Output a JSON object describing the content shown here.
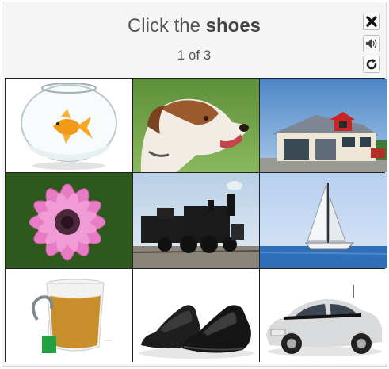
{
  "captcha": {
    "prompt_prefix": "Click the",
    "prompt_target": "shoes",
    "progress": "1 of 3",
    "controls": [
      {
        "name": "close-icon",
        "glyph": "✖"
      },
      {
        "name": "audio-icon",
        "glyph": "🔊"
      },
      {
        "name": "refresh-icon",
        "glyph": "↻"
      }
    ],
    "tiles": [
      {
        "name": "tile-goldfish"
      },
      {
        "name": "tile-dog"
      },
      {
        "name": "tile-house"
      },
      {
        "name": "tile-flower"
      },
      {
        "name": "tile-locomotive"
      },
      {
        "name": "tile-sailboat"
      },
      {
        "name": "tile-tea"
      },
      {
        "name": "tile-shoes"
      },
      {
        "name": "tile-car"
      }
    ]
  }
}
